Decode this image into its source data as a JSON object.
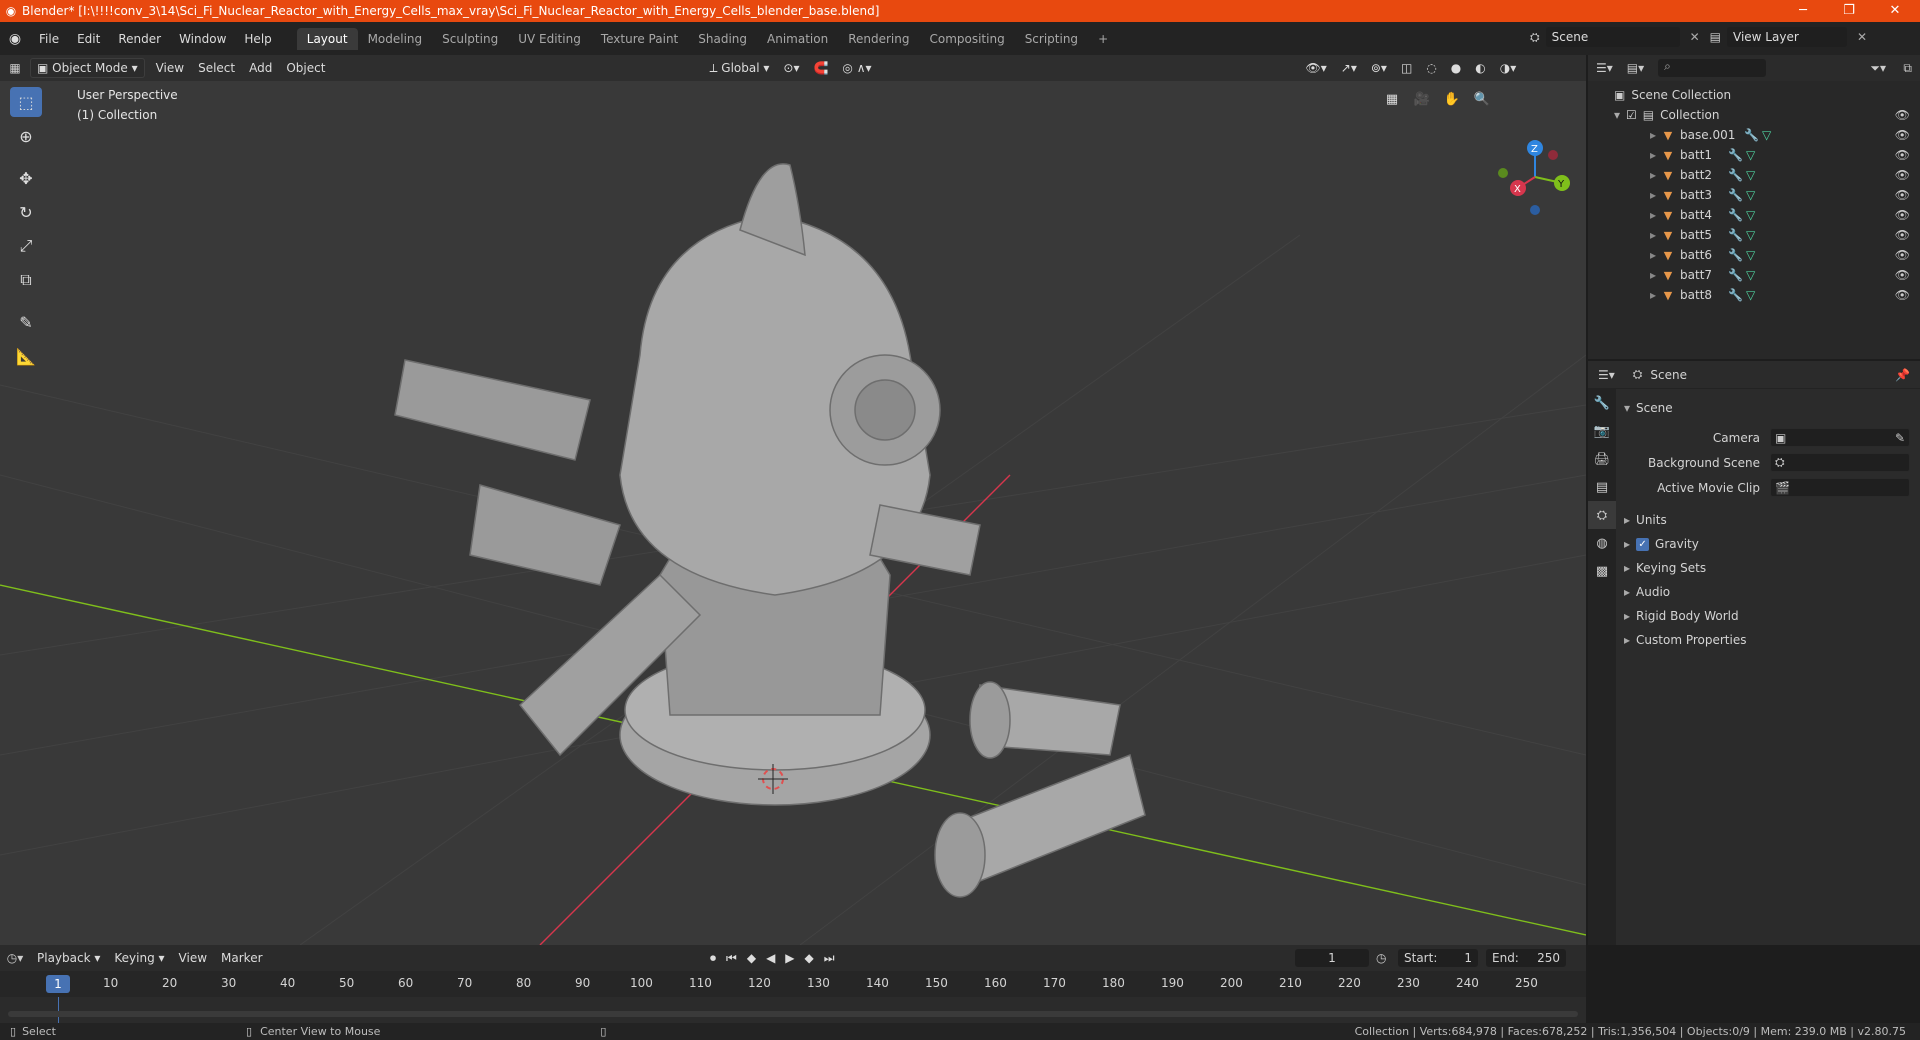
{
  "titlebar": {
    "title": "Blender* [I:\\!!!!conv_3\\14\\Sci_Fi_Nuclear_Reactor_with_Energy_Cells_max_vray\\Sci_Fi_Nuclear_Reactor_with_Energy_Cells_blender_base.blend]",
    "minimize": "─",
    "maximize": "❐",
    "close": "✕"
  },
  "menubar": {
    "menus": [
      "File",
      "Edit",
      "Render",
      "Window",
      "Help"
    ],
    "workspaces": [
      "Layout",
      "Modeling",
      "Sculpting",
      "UV Editing",
      "Texture Paint",
      "Shading",
      "Animation",
      "Rendering",
      "Compositing",
      "Scripting"
    ],
    "add_workspace": "+",
    "scene": "Scene",
    "view_layer": "View Layer"
  },
  "viewport": {
    "mode": "Object Mode",
    "menus": [
      "View",
      "Select",
      "Add",
      "Object"
    ],
    "transform_orientation": "Global",
    "perspective_label": "User Perspective",
    "collection_label": "(1) Collection",
    "gizmo": {
      "x": "X",
      "y": "Y",
      "z": "Z"
    }
  },
  "outliner": {
    "root": "Scene Collection",
    "collection": "Collection",
    "objects": [
      "base.001",
      "batt1",
      "batt2",
      "batt3",
      "batt4",
      "batt5",
      "batt6",
      "batt7",
      "batt8"
    ]
  },
  "properties": {
    "context_label": "Scene",
    "section": "Scene",
    "fields": [
      {
        "label": "Camera",
        "value": ""
      },
      {
        "label": "Background Scene",
        "value": ""
      },
      {
        "label": "Active Movie Clip",
        "value": ""
      }
    ],
    "panels": [
      "Units",
      "Gravity",
      "Keying Sets",
      "Audio",
      "Rigid Body World",
      "Custom Properties"
    ],
    "gravity_checked": true
  },
  "timeline": {
    "menus": [
      "Playback",
      "Keying",
      "View",
      "Marker"
    ],
    "current_frame": "1",
    "start_label": "Start:",
    "start": "1",
    "end_label": "End:",
    "end": "250",
    "ticks": [
      "1",
      "10",
      "20",
      "30",
      "40",
      "50",
      "60",
      "70",
      "80",
      "90",
      "100",
      "110",
      "120",
      "130",
      "140",
      "150",
      "160",
      "170",
      "180",
      "190",
      "200",
      "210",
      "220",
      "230",
      "240",
      "250"
    ]
  },
  "statusbar": {
    "left_action": "Select",
    "middle_action": "Center View to Mouse",
    "stats": "Collection | Verts:684,978 | Faces:678,252 | Tris:1,356,504 | Objects:0/9 | Mem: 239.0 MB | v2.80.75"
  },
  "colors": {
    "titlebar": "#e8490f",
    "accent": "#4772b3",
    "mesh_icon": "#e6974a",
    "axis_x": "#d6364d",
    "axis_y": "#7fbf1b",
    "axis_z": "#2f86e0"
  }
}
